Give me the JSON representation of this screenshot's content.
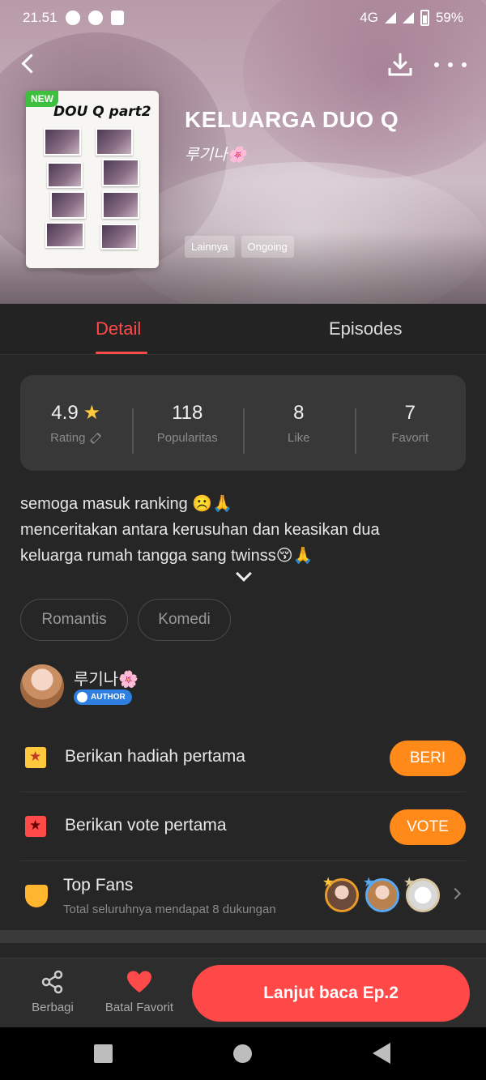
{
  "status_bar": {
    "time": "21.51",
    "network": "4G",
    "battery": "59%"
  },
  "hero": {
    "new_badge": "NEW",
    "cover_title": "DOU Q part2",
    "title": "KELUARGA DUO Q",
    "author": "루기나🌸",
    "tags": [
      "Lainnya",
      "Ongoing"
    ]
  },
  "tabs": {
    "active": "Detail",
    "other": "Episodes"
  },
  "stats": {
    "rating_value": "4.9",
    "rating_label": "Rating",
    "popularity_value": "118",
    "popularity_label": "Popularitas",
    "like_value": "8",
    "like_label": "Like",
    "favorite_value": "7",
    "favorite_label": "Favorit"
  },
  "description": {
    "line1": "semoga masuk ranking ☹️🙏",
    "line2": "menceritakan antara kerusuhan dan keasikan dua",
    "line3": "keluarga rumah tangga sang twinss😚🙏"
  },
  "genres": [
    "Romantis",
    "Komedi"
  ],
  "author_row": {
    "name": "루기나🌸",
    "badge": "AUTHOR"
  },
  "gift": {
    "text": "Berikan hadiah pertama",
    "button": "BERI"
  },
  "vote": {
    "text": "Berikan vote pertama",
    "button": "VOTE"
  },
  "fans": {
    "title": "Top Fans",
    "subtitle": "Total seluruhnya mendapat 8 dukungan"
  },
  "bottom_bar": {
    "share_label": "Berbagi",
    "favorite_label": "Batal Favorit",
    "cta": "Lanjut baca Ep.2"
  },
  "colors": {
    "accent_red": "#ff4a4a",
    "accent_orange": "#ff8a1a",
    "star_yellow": "#ffc83d",
    "background": "#262626"
  }
}
